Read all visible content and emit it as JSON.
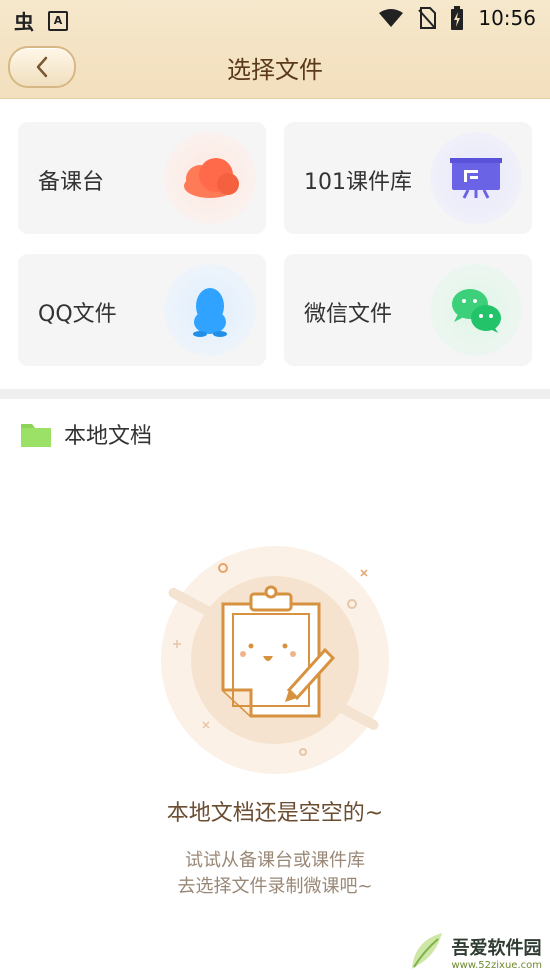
{
  "status_bar": {
    "left_icons": [
      "bug-notification-icon",
      "keyboard-a-icon"
    ],
    "right_icons": [
      "wifi-icon",
      "no-sim-icon",
      "battery-charging-icon"
    ],
    "time": "10:56"
  },
  "header": {
    "title": "选择文件"
  },
  "sources": [
    {
      "label": "备课台",
      "icon": "cloud-icon",
      "accent": "#f26a4b"
    },
    {
      "label": "101课件库",
      "icon": "presentation-board-icon",
      "accent": "#6a63e6"
    },
    {
      "label": "QQ文件",
      "icon": "qq-penguin-icon",
      "accent": "#2fa3ff"
    },
    {
      "label": "微信文件",
      "icon": "wechat-icon",
      "accent": "#23c36a"
    }
  ],
  "local": {
    "title": "本地文档"
  },
  "empty": {
    "main": "本地文档还是空空的~",
    "sub_line1": "试试从备课台或课件库",
    "sub_line2": "去选择文件录制微课吧~"
  },
  "watermark": {
    "brand": "吾爱软件园",
    "url": "www.52zixue.com"
  },
  "colors": {
    "header_bg": "#f2dfbd",
    "title_text": "#5b3a1a",
    "folder_green": "#8fd45a"
  }
}
